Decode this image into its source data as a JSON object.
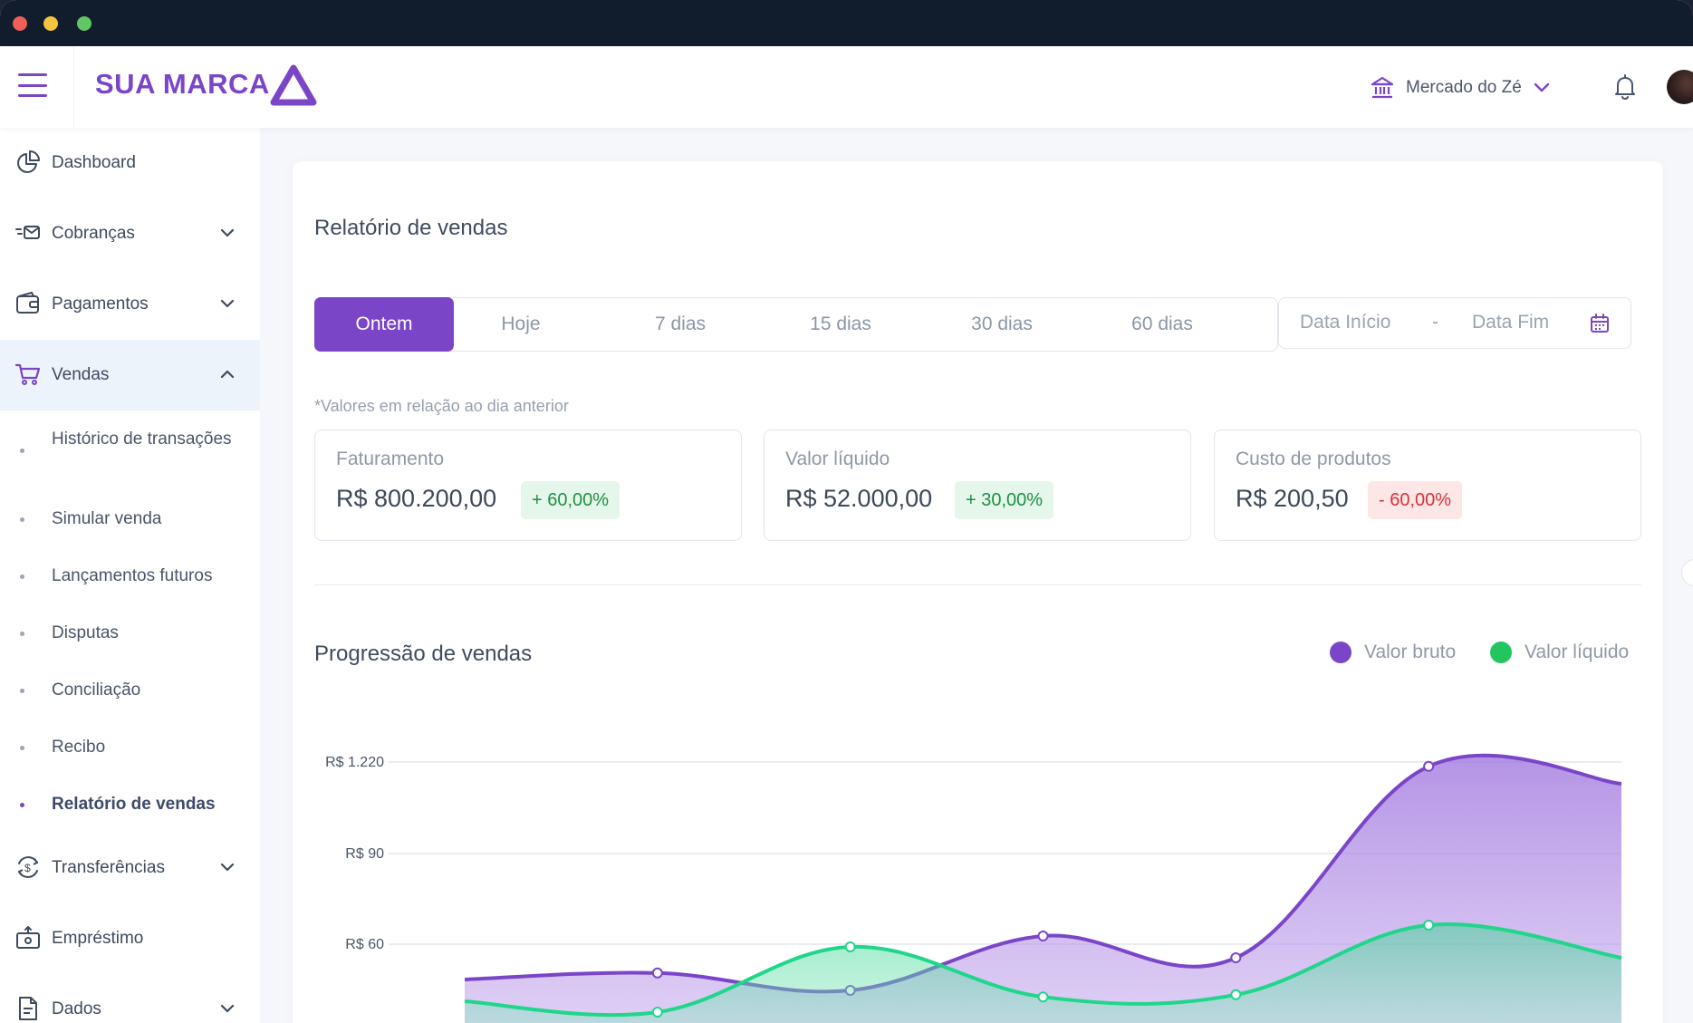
{
  "header": {
    "brand": "SUA MARCA",
    "store_name": "Mercado do Zé"
  },
  "sidebar": {
    "items": [
      {
        "label": "Dashboard",
        "icon": "pie-chart-icon"
      },
      {
        "label": "Cobranças",
        "icon": "billing-icon"
      },
      {
        "label": "Pagamentos",
        "icon": "wallet-icon"
      },
      {
        "label": "Vendas",
        "icon": "cart-icon"
      },
      {
        "label": "Transferências",
        "icon": "transfer-icon"
      },
      {
        "label": "Empréstimo",
        "icon": "loan-icon"
      },
      {
        "label": "Dados",
        "icon": "document-icon"
      }
    ],
    "vendas_subitems": [
      {
        "label": "Histórico de transações"
      },
      {
        "label": "Simular venda"
      },
      {
        "label": "Lançamentos futuros"
      },
      {
        "label": "Disputas"
      },
      {
        "label": "Conciliação"
      },
      {
        "label": "Recibo"
      },
      {
        "label": "Relatório de vendas"
      }
    ]
  },
  "report": {
    "title": "Relatório de vendas",
    "periods": [
      "Ontem",
      "Hoje",
      "7 dias",
      "15 dias",
      "30 dias",
      "60 dias"
    ],
    "active_period": "Ontem",
    "date_range": {
      "start_placeholder": "Data Início",
      "separator": "-",
      "end_placeholder": "Data Fim"
    },
    "note": "*Valores em relação ao dia anterior",
    "kpis": [
      {
        "label": "Faturamento",
        "value": "R$ 800.200,00",
        "change": "+ 60,00%",
        "trend": "up"
      },
      {
        "label": "Valor líquido",
        "value": "R$ 52.000,00",
        "change": "+ 30,00%",
        "trend": "up"
      },
      {
        "label": "Custo de produtos",
        "value": "R$ 200,50",
        "change": "- 60,00%",
        "trend": "down"
      }
    ]
  },
  "chart_data": {
    "type": "area",
    "title": "Progressão de vendas",
    "y_tick_labels": [
      "R$ 1.220",
      "R$ 90",
      "R$ 60"
    ],
    "series": [
      {
        "name": "Valor bruto",
        "color": "#7b45c8",
        "values": [
          20,
          23,
          15,
          40,
          30,
          118,
          110
        ]
      },
      {
        "name": "Valor líquido",
        "color": "#22c55e",
        "values": [
          10,
          5,
          35,
          12,
          13,
          45,
          30
        ]
      }
    ],
    "legend_position": "top-right",
    "grid": true
  },
  "colors": {
    "accent": "#7b45c8",
    "positive": "#1f8f43",
    "negative": "#d8323a"
  }
}
